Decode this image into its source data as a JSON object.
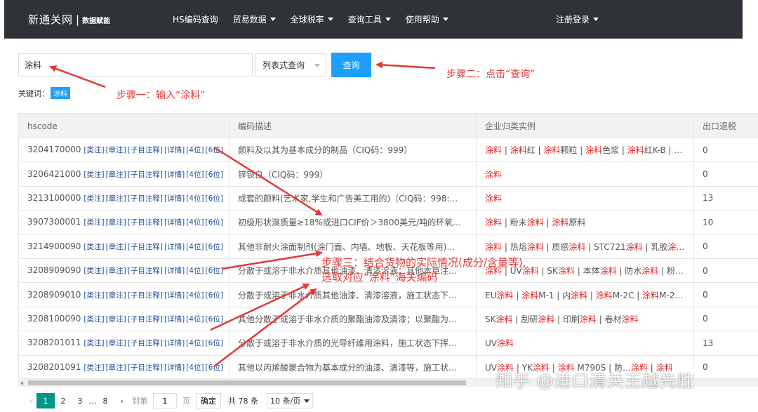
{
  "navbar": {
    "brand_name": "新通关网",
    "brand_sep": "|",
    "brand_tag": "数据赋能",
    "items": [
      {
        "label": "HS编码查询",
        "dropdown": false
      },
      {
        "label": "贸易数据",
        "dropdown": true
      },
      {
        "label": "全球税率",
        "dropdown": true
      },
      {
        "label": "查询工具",
        "dropdown": true
      },
      {
        "label": "使用帮助",
        "dropdown": true
      }
    ],
    "login": "注册登录"
  },
  "search": {
    "value": "涂料",
    "mode": "列表式查询",
    "button": "查询"
  },
  "keywords": {
    "label": "关键词：",
    "tag": "涂料"
  },
  "table": {
    "columns": [
      "hscode",
      "编码描述",
      "企业归类实例",
      "出口退税"
    ],
    "links": [
      "[类注]",
      "[章注]",
      "[子目注释]",
      "[详情]",
      "[4位]",
      "[6位]"
    ],
    "rows": [
      {
        "code": "3204170000",
        "desc": "颜料及以其为基本成分的制品（CIQ码：999）",
        "ex": [
          [
            "涂料",
            1
          ],
          [
            " | ",
            0
          ],
          [
            "涂料",
            1
          ],
          [
            "红 | ",
            0
          ],
          [
            "涂料",
            1
          ],
          [
            "颗粒 | ",
            0
          ],
          [
            "涂料",
            1
          ],
          [
            "色浆 | ",
            0
          ],
          [
            "涂料",
            1
          ],
          [
            "红K-B | …",
            0
          ]
        ],
        "rebate": "0"
      },
      {
        "code": "3206421000",
        "desc": "锌钡白（CIQ码：999）",
        "ex": [
          [
            "涂料",
            1
          ]
        ],
        "rebate": "0"
      },
      {
        "code": "3213100000",
        "desc": "成套的颜料(艺术家,学生和广告美工用的)（CIQ码：998:…",
        "ex": [
          [
            "涂料",
            1
          ]
        ],
        "rebate": "13"
      },
      {
        "code": "3907300001",
        "desc": "初级形状溴质量≥18%或进口CIF价＞3800美元/吨的环氧…",
        "ex": [
          [
            "涂料",
            1
          ],
          [
            " | 粉末",
            0
          ],
          [
            "涂料",
            1
          ],
          [
            " | ",
            0
          ],
          [
            "涂料",
            1
          ],
          [
            "原料",
            0
          ]
        ],
        "rebate": "10"
      },
      {
        "code": "3214900090",
        "desc": "其他非耐火涂面制剂(涂门面、内墙、地板、天花板等用)…",
        "ex": [
          [
            "涂料",
            1
          ],
          [
            " | 热熔",
            0
          ],
          [
            "涂料",
            1
          ],
          [
            " | 质感",
            0
          ],
          [
            "涂料",
            1
          ],
          [
            " | STC721",
            0
          ],
          [
            "涂料",
            1
          ],
          [
            " | 乳胶",
            0
          ],
          [
            "涂…",
            1
          ]
        ],
        "rebate": "0"
      },
      {
        "code": "3208909090",
        "desc": "分散于或溶于非水介质其他油漆、清漆溶液；其他本章注…",
        "ex": [
          [
            "涂料",
            1
          ],
          [
            " | UV",
            0
          ],
          [
            "涂料",
            1
          ],
          [
            " | SK",
            0
          ],
          [
            "涂料",
            1
          ],
          [
            " | 本体",
            0
          ],
          [
            "涂料",
            1
          ],
          [
            " | 防水",
            0
          ],
          [
            "涂料",
            1
          ],
          [
            " | 粉…",
            0
          ]
        ],
        "rebate": "0"
      },
      {
        "code": "3208909010",
        "desc": "分散于或溶于非水介质其他油漆、清漆溶液，施工状态下…",
        "ex": [
          [
            "EU",
            0
          ],
          [
            "涂料",
            1
          ],
          [
            " | ",
            0
          ],
          [
            "涂料",
            1
          ],
          [
            "M-1 | 内",
            0
          ],
          [
            "涂料",
            1
          ],
          [
            " | ",
            0
          ],
          [
            "涂料",
            1
          ],
          [
            "M-2C | ",
            0
          ],
          [
            "涂料",
            1
          ],
          [
            "M-21…",
            0
          ]
        ],
        "rebate": "0"
      },
      {
        "code": "3208100090",
        "desc": "其他分散于或溶于非水介质的聚酯油漆及清漆；以聚酯为…",
        "ex": [
          [
            "SK",
            0
          ],
          [
            "涂料",
            1
          ],
          [
            " | 刮研",
            0
          ],
          [
            "涂料",
            1
          ],
          [
            " | 印刷",
            0
          ],
          [
            "涂料",
            1
          ],
          [
            " | 卷材",
            0
          ],
          [
            "涂料",
            1
          ]
        ],
        "rebate": "0"
      },
      {
        "code": "3208201011",
        "desc": "分散于或溶于非水介质的光导纤维用涂料，施工状态下挥…",
        "ex": [
          [
            "UV",
            0
          ],
          [
            "涂料",
            1
          ]
        ],
        "rebate": "13"
      },
      {
        "code": "3208201091",
        "desc": "其他以丙烯酸聚合物为基本成分的油漆、清漆等，施工状…",
        "ex": [
          [
            "UV",
            0
          ],
          [
            "涂料",
            1
          ],
          [
            " | YK",
            0
          ],
          [
            "涂料",
            1
          ],
          [
            " | ",
            0
          ],
          [
            "涂料",
            1
          ],
          [
            " M790S | 防…",
            0
          ],
          [
            "涂料",
            1
          ],
          [
            " | ",
            0
          ],
          [
            "涂料",
            1
          ]
        ],
        "rebate": "0"
      }
    ]
  },
  "pager": {
    "prev": "‹",
    "pages": [
      "1",
      "2",
      "3",
      "…",
      "8"
    ],
    "next": "›",
    "goto_label": "到第",
    "goto_value": "1",
    "page_unit": "页",
    "confirm": "确定",
    "total": "共 78 条",
    "size": "10 条/页"
  },
  "annotations": {
    "step1": "步骤一：输入“涂料”",
    "step2": "步骤二：点击“查询”",
    "step3_line1": "步骤三：结合货物的实际情况(成分/含量等),",
    "step3_line2": "选取对应“涂料”海关编码"
  },
  "watermark": "知乎 @进口清关王越先胜",
  "colors": {
    "nav_bg": "#2f3338",
    "accent": "#1e9fff",
    "highlight": "#e02020",
    "pager_active": "#009688",
    "annotation": "#e53935"
  }
}
